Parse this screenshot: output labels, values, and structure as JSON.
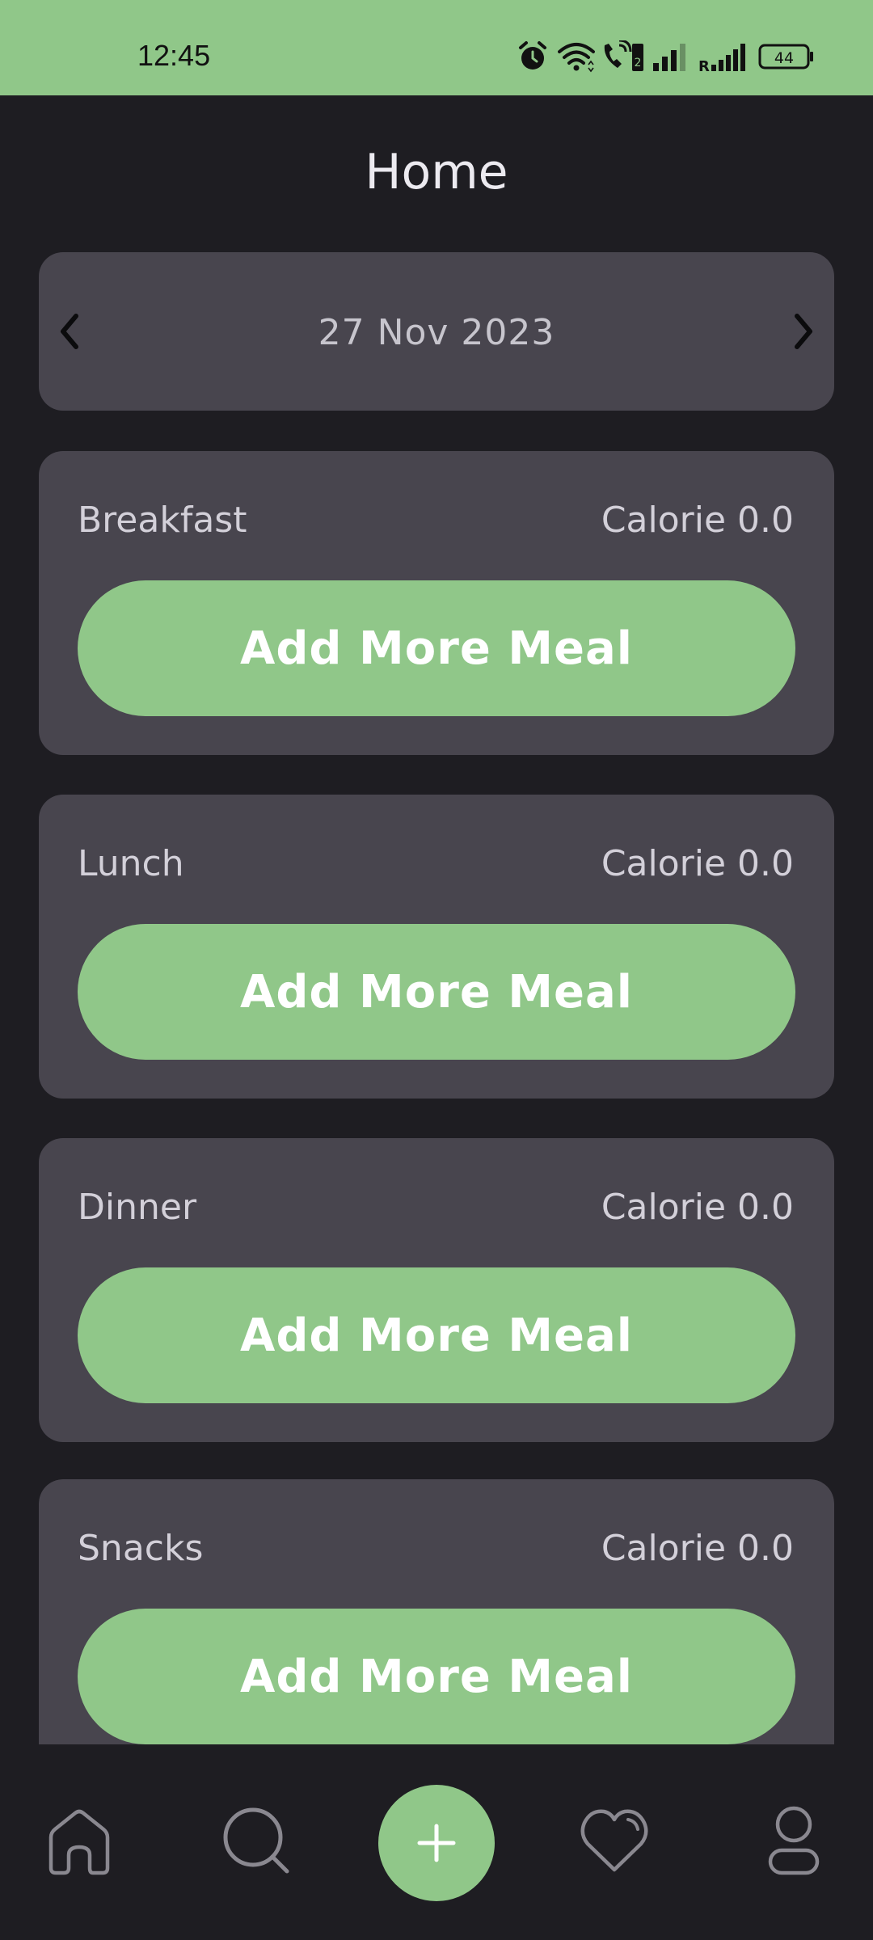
{
  "status_bar": {
    "time": "12:45",
    "battery": "44",
    "roaming_label": "R",
    "sim_label": "2",
    "icons": [
      "alarm-icon",
      "wifi-icon",
      "volte-call-icon",
      "signal-icon",
      "roaming-signal-icon",
      "battery-icon"
    ]
  },
  "header": {
    "title": "Home"
  },
  "date_picker": {
    "date": "27 Nov 2023",
    "prev_icon": "chevron-left-icon",
    "next_icon": "chevron-right-icon"
  },
  "meals": [
    {
      "name": "Breakfast",
      "calorie": "Calorie 0.0",
      "button": "Add More Meal"
    },
    {
      "name": "Lunch",
      "calorie": "Calorie 0.0",
      "button": "Add More Meal"
    },
    {
      "name": "Dinner",
      "calorie": "Calorie 0.0",
      "button": "Add More Meal"
    },
    {
      "name": "Snacks",
      "calorie": "Calorie 0.0",
      "button": "Add More Meal"
    }
  ],
  "bottom_nav": {
    "items": [
      "home-icon",
      "search-icon",
      "plus-icon",
      "heart-icon",
      "profile-icon"
    ]
  },
  "colors": {
    "accent": "#90c789",
    "background": "#1e1d22",
    "card": "#48454e"
  }
}
